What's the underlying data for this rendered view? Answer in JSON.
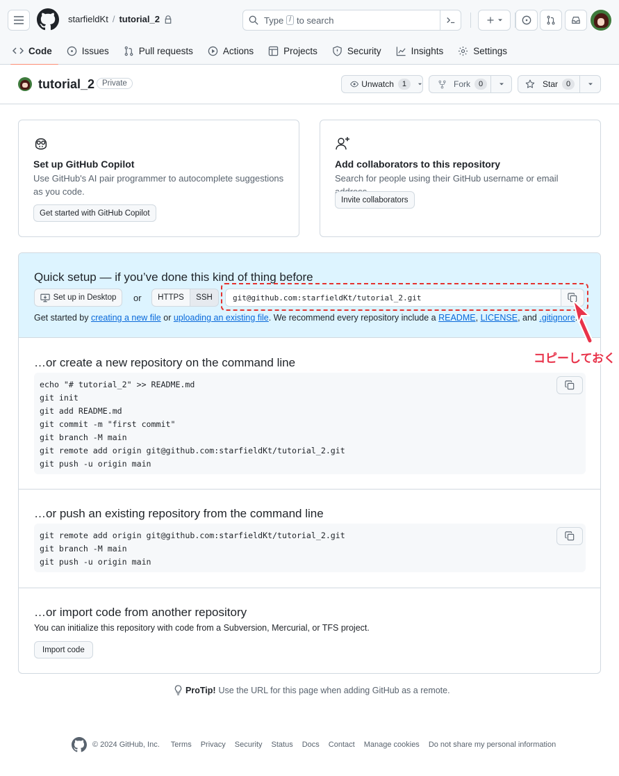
{
  "header": {
    "owner": "starfieldKt",
    "separator": "/",
    "repo": "tutorial_2",
    "search": {
      "prefix": "Type",
      "key": "/",
      "suffix": "to search"
    }
  },
  "tabs": [
    {
      "label": "Code",
      "icon": "code-icon",
      "active": true
    },
    {
      "label": "Issues",
      "icon": "issue-opened-icon"
    },
    {
      "label": "Pull requests",
      "icon": "git-pull-request-icon"
    },
    {
      "label": "Actions",
      "icon": "play-icon"
    },
    {
      "label": "Projects",
      "icon": "table-icon"
    },
    {
      "label": "Security",
      "icon": "shield-icon"
    },
    {
      "label": "Insights",
      "icon": "graph-icon"
    },
    {
      "label": "Settings",
      "icon": "gear-icon"
    }
  ],
  "repo_head": {
    "name": "tutorial_2",
    "visibility": "Private",
    "unwatch_label": "Unwatch",
    "unwatch_count": "1",
    "fork_label": "Fork",
    "fork_count": "0",
    "star_label": "Star",
    "star_count": "0"
  },
  "copilot_card": {
    "title": "Set up GitHub Copilot",
    "description": "Use GitHub's AI pair programmer to autocomplete suggestions as you code.",
    "button": "Get started with GitHub Copilot"
  },
  "collab_card": {
    "title": "Add collaborators to this repository",
    "description": "Search for people using their GitHub username or email address.",
    "button": "Invite collaborators"
  },
  "quick_setup": {
    "title": "Quick setup — if you’ve done this kind of thing before",
    "desktop_button": "Set up in Desktop",
    "or": "or",
    "https": "HTTPS",
    "ssh": "SSH",
    "url": "git@github.com:starfieldKt/tutorial_2.git",
    "hint_1": "Get started by",
    "link_new_file": "creating a new file",
    "hint_2": "or",
    "link_upload": "uploading an existing file",
    "hint_3": ". We recommend every repository include a",
    "link_readme": "README",
    "hint_4": ",",
    "link_license": "LICENSE",
    "hint_5": ", and",
    "link_gitignore": ".gitignore",
    "hint_6": "."
  },
  "annotation": "コピーしておく",
  "section_new": {
    "title": "…or create a new repository on the command line",
    "code": "echo \"# tutorial_2\" >> README.md\ngit init\ngit add README.md\ngit commit -m \"first commit\"\ngit branch -M main\ngit remote add origin git@github.com:starfieldKt/tutorial_2.git\ngit push -u origin main"
  },
  "section_push": {
    "title": "…or push an existing repository from the command line",
    "code": "git remote add origin git@github.com:starfieldKt/tutorial_2.git\ngit branch -M main\ngit push -u origin main"
  },
  "section_import": {
    "title": "…or import code from another repository",
    "description": "You can initialize this repository with code from a Subversion, Mercurial, or TFS project.",
    "button": "Import code"
  },
  "protip": {
    "label": "ProTip!",
    "text": "Use the URL for this page when adding GitHub as a remote."
  },
  "footer": {
    "copyright": "© 2024 GitHub, Inc.",
    "links": [
      "Terms",
      "Privacy",
      "Security",
      "Status",
      "Docs",
      "Contact",
      "Manage cookies",
      "Do not share my personal information"
    ]
  },
  "colors": {
    "accent": "#0969da",
    "tab_underline": "#fd8c73",
    "setup_bg": "#ddf4ff",
    "annotation": "#e8334a"
  }
}
